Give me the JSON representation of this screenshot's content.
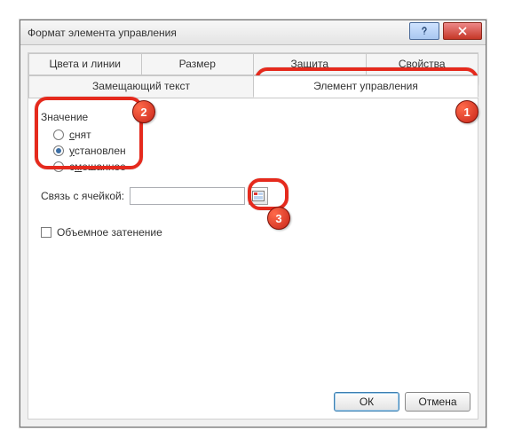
{
  "window": {
    "title": "Формат элемента управления"
  },
  "tabs": {
    "row1": [
      "Цвета и линии",
      "Размер",
      "Защита",
      "Свойства"
    ],
    "row2": [
      "Замещающий текст",
      "Элемент управления"
    ],
    "active": "Элемент управления"
  },
  "fieldset": {
    "legend": "Значение",
    "options": [
      {
        "label": "снят",
        "underline_first": "с",
        "rest": "нят",
        "checked": false
      },
      {
        "label": "установлен",
        "underline_first": "у",
        "rest": "становлен",
        "checked": true
      },
      {
        "label": "смешанное",
        "underline_first": "",
        "rest": "с",
        "mid_u": "м",
        "tail": "ешанное",
        "checked": false
      }
    ]
  },
  "cell_link": {
    "label_pre": "Связь с ",
    "label_u": "я",
    "label_post": "чейкой:",
    "value": ""
  },
  "shading": {
    "label_u": "О",
    "label_rest": "бъемное затенение",
    "checked": false
  },
  "buttons": {
    "ok": "ОК",
    "cancel": "Отмена"
  },
  "annotations": {
    "b1": "1",
    "b2": "2",
    "b3": "3"
  }
}
